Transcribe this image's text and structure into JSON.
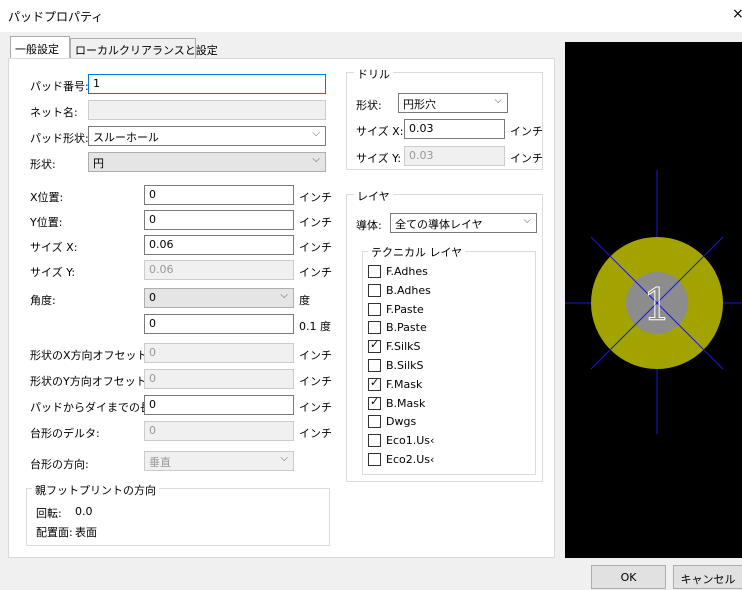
{
  "window": {
    "title": "パッドプロパティ",
    "close_glyph": "×"
  },
  "tabs": [
    "一般設定",
    "ローカルクリアランスと設定"
  ],
  "general": {
    "pad_number_label": "パッド番号:",
    "pad_number_value": "1",
    "net_name_label": "ネット名:",
    "net_name_value": "",
    "pad_type_label": "パッド形状:",
    "pad_type_value": "スルーホール",
    "shape_label": "形状:",
    "shape_value": "円"
  },
  "params": [
    {
      "label": "X位置:",
      "value": "0",
      "unit": "インチ",
      "disabled": false
    },
    {
      "label": "Y位置:",
      "value": "0",
      "unit": "インチ",
      "disabled": false
    },
    {
      "label": "サイズ X:",
      "value": "0.06",
      "unit": "インチ",
      "disabled": false
    },
    {
      "label": "サイズ Y:",
      "value": "0.06",
      "unit": "インチ",
      "disabled": true
    }
  ],
  "angle": {
    "label": "角度:",
    "combo_value": "0",
    "unit": "度",
    "field_value": "0",
    "field_unit": "0.1 度"
  },
  "offsets": [
    {
      "label": "形状のX方向オフセット:",
      "value": "0",
      "unit": "インチ",
      "disabled": true
    },
    {
      "label": "形状のY方向オフセット:",
      "value": "0",
      "unit": "インチ",
      "disabled": true
    },
    {
      "label": "パッドからダイまでの長さ:",
      "value": "0",
      "unit": "インチ",
      "disabled": false
    },
    {
      "label": "台形のデルタ:",
      "value": "0",
      "unit": "インチ",
      "disabled": true
    }
  ],
  "trapezoid_dir": {
    "label": "台形の方向:",
    "value": "垂直"
  },
  "parent": {
    "title": "親フットプリントの方向",
    "rotation_label": "回転:",
    "rotation_value": "0.0",
    "side_label": "配置面:",
    "side_value": "表面"
  },
  "drill": {
    "title": "ドリル",
    "shape_label": "形状:",
    "shape_value": "円形穴",
    "size_x_label": "サイズ X:",
    "size_x_value": "0.03",
    "size_x_unit": "インチ",
    "size_y_label": "サイズ Y:",
    "size_y_value": "0.03",
    "size_y_unit": "インチ"
  },
  "layers": {
    "title": "レイヤ",
    "conductor_label": "導体:",
    "conductor_value": "全ての導体レイヤ",
    "technical_title": "テクニカル レイヤ",
    "items": [
      {
        "label": "F.Adhes",
        "checked": false
      },
      {
        "label": "B.Adhes",
        "checked": false
      },
      {
        "label": "F.Paste",
        "checked": false
      },
      {
        "label": "B.Paste",
        "checked": false
      },
      {
        "label": "F.SilkS",
        "checked": true
      },
      {
        "label": "B.SilkS",
        "checked": false
      },
      {
        "label": "F.Mask",
        "checked": true
      },
      {
        "label": "B.Mask",
        "checked": true
      },
      {
        "label": "Dwgs",
        "checked": false
      },
      {
        "label": "Eco1.Us‹",
        "checked": false
      },
      {
        "label": "Eco2.Us‹",
        "checked": false
      }
    ]
  },
  "preview": {
    "pad_label": "1",
    "pad_color": "#a3a300",
    "hole_color": "#8c8c8c",
    "cross_color": "#1a1ad9"
  },
  "buttons": {
    "ok": "OK",
    "cancel": "キャンセル"
  }
}
